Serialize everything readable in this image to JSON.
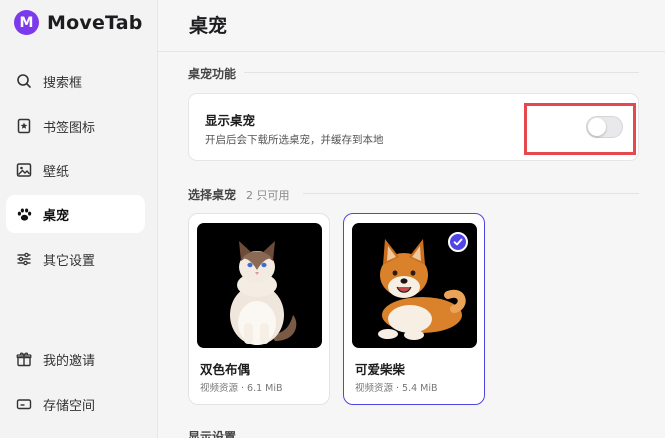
{
  "app": {
    "name": "MoveTab",
    "logo_letter": "M",
    "accent": "#7c3aed"
  },
  "sidebar": {
    "items": [
      {
        "label": "搜索框",
        "icon": "search-icon",
        "active": false
      },
      {
        "label": "书签图标",
        "icon": "bookmark-icon",
        "active": false
      },
      {
        "label": "壁纸",
        "icon": "image-icon",
        "active": false
      },
      {
        "label": "桌宠",
        "icon": "paw-icon",
        "active": true
      },
      {
        "label": "其它设置",
        "icon": "sliders-icon",
        "active": false
      }
    ],
    "bottom_items": [
      {
        "label": "我的邀请",
        "icon": "gift-icon"
      },
      {
        "label": "存储空间",
        "icon": "storage-icon"
      }
    ]
  },
  "page": {
    "title": "桌宠"
  },
  "pet_feature": {
    "section_title": "桌宠功能",
    "toggle_title": "显示桌宠",
    "toggle_desc": "开启后会下载所选桌宠，并缓存到本地",
    "toggle_on": false
  },
  "pet_select": {
    "section_title": "选择桌宠",
    "available": "2 只可用",
    "pets": [
      {
        "name": "双色布偶",
        "meta": "视频资源 · 6.1 MiB",
        "selected": false,
        "image": "ragdoll-cat-image"
      },
      {
        "name": "可爱柴柴",
        "meta": "视频资源 · 5.4 MiB",
        "selected": true,
        "image": "shiba-dog-image"
      }
    ]
  },
  "display_settings": {
    "section_title": "显示设置"
  },
  "colors": {
    "selected_border": "#4f46e5",
    "highlight": "#e5484d",
    "active_bg": "#ffffff"
  }
}
